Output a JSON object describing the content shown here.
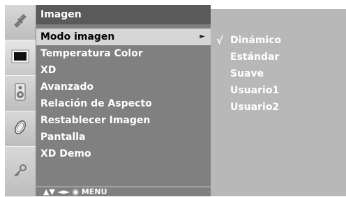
{
  "rail": {
    "icons": [
      "satellite-icon",
      "picture-icon",
      "speaker-icon",
      "clock-icon",
      "key-icon"
    ],
    "active_index": 1
  },
  "menu": {
    "title": "Imagen",
    "items": [
      {
        "label": "Modo imagen",
        "selected": true,
        "has_submenu": true,
        "arrow": "►"
      },
      {
        "label": "Temperatura Color"
      },
      {
        "label": "XD"
      },
      {
        "label": "Avanzado"
      },
      {
        "label": "Relación de Aspecto"
      },
      {
        "label": "Restablecer Imagen"
      },
      {
        "label": "Pantalla"
      },
      {
        "label": "XD Demo"
      }
    ],
    "footer": "▲▼ ◄► ◉ MENU"
  },
  "submenu": {
    "check_mark": "√",
    "items": [
      {
        "label": "Dinámico",
        "checked": true
      },
      {
        "label": "Estándar"
      },
      {
        "label": "Suave"
      },
      {
        "label": "Usuario1"
      },
      {
        "label": "Usuario2"
      }
    ]
  }
}
